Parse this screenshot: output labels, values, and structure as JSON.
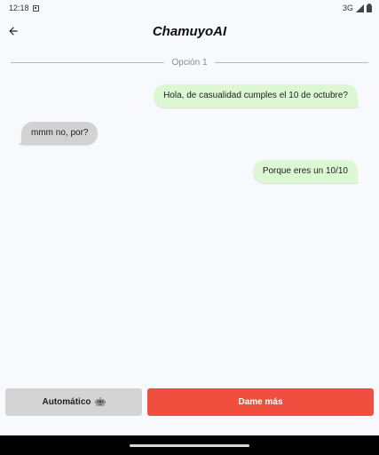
{
  "status_bar": {
    "time": "12:18",
    "network": "3G"
  },
  "app_bar": {
    "title": "ChamuyoAI",
    "back_icon": "arrow-back-icon"
  },
  "conversation": {
    "option_label": "Opción 1",
    "messages": [
      {
        "sender": "user",
        "text": "Hola, de casualidad cumples el 10 de octubre?"
      },
      {
        "sender": "other",
        "text": "mmm no, por?"
      },
      {
        "sender": "user",
        "text": "Porque eres un 10/10"
      }
    ]
  },
  "actions": {
    "auto_label": "Automático",
    "auto_icon": "robot-icon",
    "more_label": "Dame más"
  },
  "colors": {
    "outgoing_bubble": "#dcf8d3",
    "incoming_bubble": "#d2d2d2",
    "primary_button": "#f04e3e",
    "secondary_button": "#d4d4d4",
    "background": "#f8f9fd"
  }
}
